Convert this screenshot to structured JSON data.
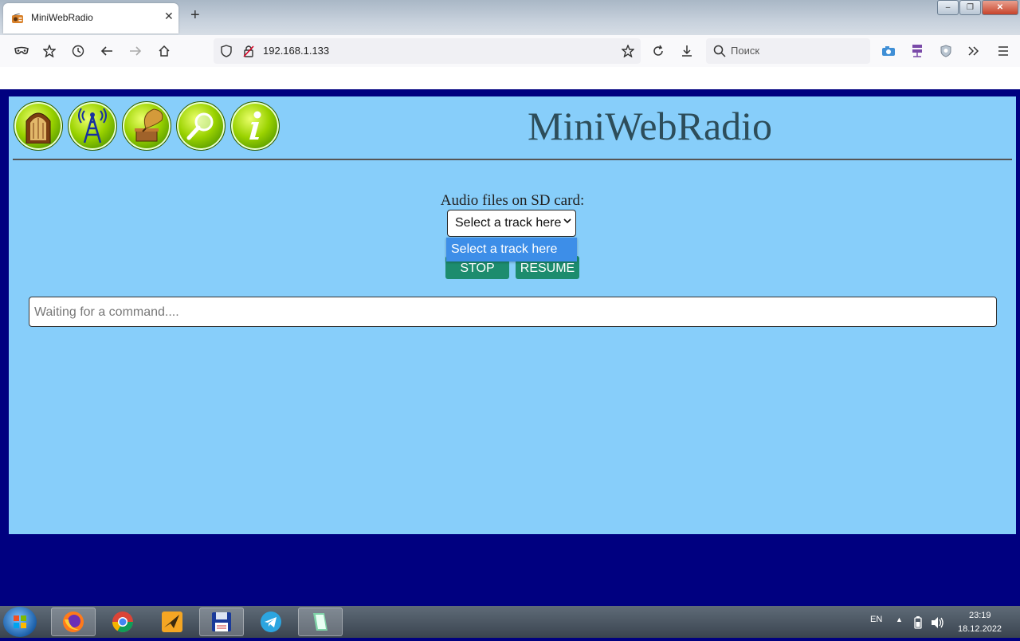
{
  "browser": {
    "tab_title": "MiniWebRadio",
    "tab_close": "✕",
    "new_tab": "+",
    "url": "192.168.1.133",
    "search_placeholder": "Поиск",
    "window_buttons": [
      "–",
      "❐",
      "✕"
    ]
  },
  "page": {
    "site_title": "MiniWebRadio",
    "nav_icons": [
      "radio-icon",
      "antenna-icon",
      "gramophone-icon",
      "search-icon",
      "info-icon"
    ],
    "sd_label": "Audio files on SD card:",
    "track_select": {
      "value": "Select a track here",
      "options": [
        "Select a track here"
      ]
    },
    "stop_label": "STOP",
    "resume_label": "RESUME",
    "command_placeholder": "Waiting for a command...."
  },
  "taskbar": {
    "language": "EN",
    "time": "23:19",
    "date": "18.12.2022"
  },
  "colors": {
    "page_bg": "#87cefa",
    "outer_bg": "#000080",
    "button_green": "#1d8c6e",
    "dropdown_highlight": "#3d8ee8"
  }
}
